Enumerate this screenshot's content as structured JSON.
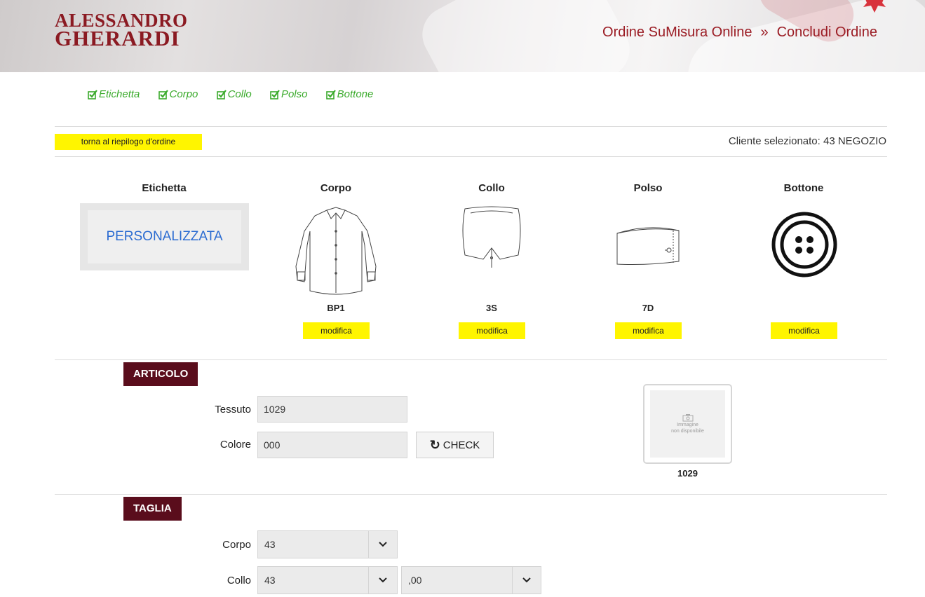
{
  "header": {
    "brand_line1": "ALESSANDRO",
    "brand_line2": "GHERARDI",
    "nav_item1": "Ordine SuMisura Online",
    "nav_separator": "»",
    "nav_item2": "Concludi Ordine",
    "brand_color": "#8b1a22"
  },
  "steps": [
    {
      "label": "Etichetta",
      "icon": "checkbox-checked-icon"
    },
    {
      "label": "Corpo",
      "icon": "checkbox-checked-icon"
    },
    {
      "label": "Collo",
      "icon": "checkbox-checked-icon"
    },
    {
      "label": "Polso",
      "icon": "checkbox-checked-icon"
    },
    {
      "label": "Bottone",
      "icon": "checkbox-checked-icon"
    }
  ],
  "toolbar": {
    "back_label": "torna al riepilogo d'ordine",
    "client_text": "Cliente selezionato: 43 NEGOZIO"
  },
  "components": {
    "etichetta": {
      "title": "Etichetta",
      "value": "PERSONALIZZATA"
    },
    "corpo": {
      "title": "Corpo",
      "code": "BP1",
      "button": "modifica"
    },
    "collo": {
      "title": "Collo",
      "code": "3S",
      "button": "modifica"
    },
    "polso": {
      "title": "Polso",
      "code": "7D",
      "button": "modifica"
    },
    "bottone": {
      "title": "Bottone",
      "code": "",
      "button": "modifica"
    }
  },
  "articolo": {
    "section_label": "ARTICOLO",
    "tessuto_label": "Tessuto",
    "tessuto_value": "1029",
    "colore_label": "Colore",
    "colore_value": "000",
    "check_label": "CHECK",
    "image_placeholder_line1": "Immagine",
    "image_placeholder_line2": "non disponibile",
    "image_code": "1029"
  },
  "taglia": {
    "section_label": "TAGLIA",
    "corpo_label": "Corpo",
    "corpo_value": "43",
    "collo_label": "Collo",
    "collo_value": "43",
    "collo_decimal": ",00"
  },
  "colors": {
    "accent_yellow": "#fff500",
    "section_bg": "#5a0d1c",
    "step_green": "#3aaa2b",
    "link_blue": "#2a6bd1"
  }
}
